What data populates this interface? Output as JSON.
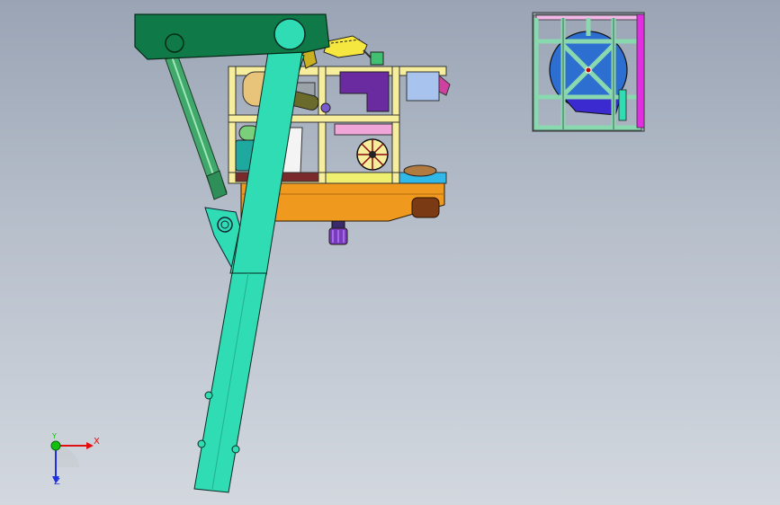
{
  "viewport": {
    "background_top": "#9aa4b4",
    "background_bottom": "#d3d8df"
  },
  "colors": {
    "boom": "#2fdcb4",
    "boom_head": "#0f7a48",
    "frame": "#f6ee9c",
    "deck": "#ef9a1e",
    "cylinder": "#3fa86a",
    "purple_block": "#6a2aa0",
    "end_frame": "#b8efd2",
    "end_disc": "#2d6fd0",
    "magenta": "#e02ee0"
  },
  "triad": {
    "x_label": "X",
    "y_label": "Y",
    "z_label": "Z",
    "x_color": "#e01010",
    "y_color": "#12c012",
    "z_color": "#2030e0"
  }
}
